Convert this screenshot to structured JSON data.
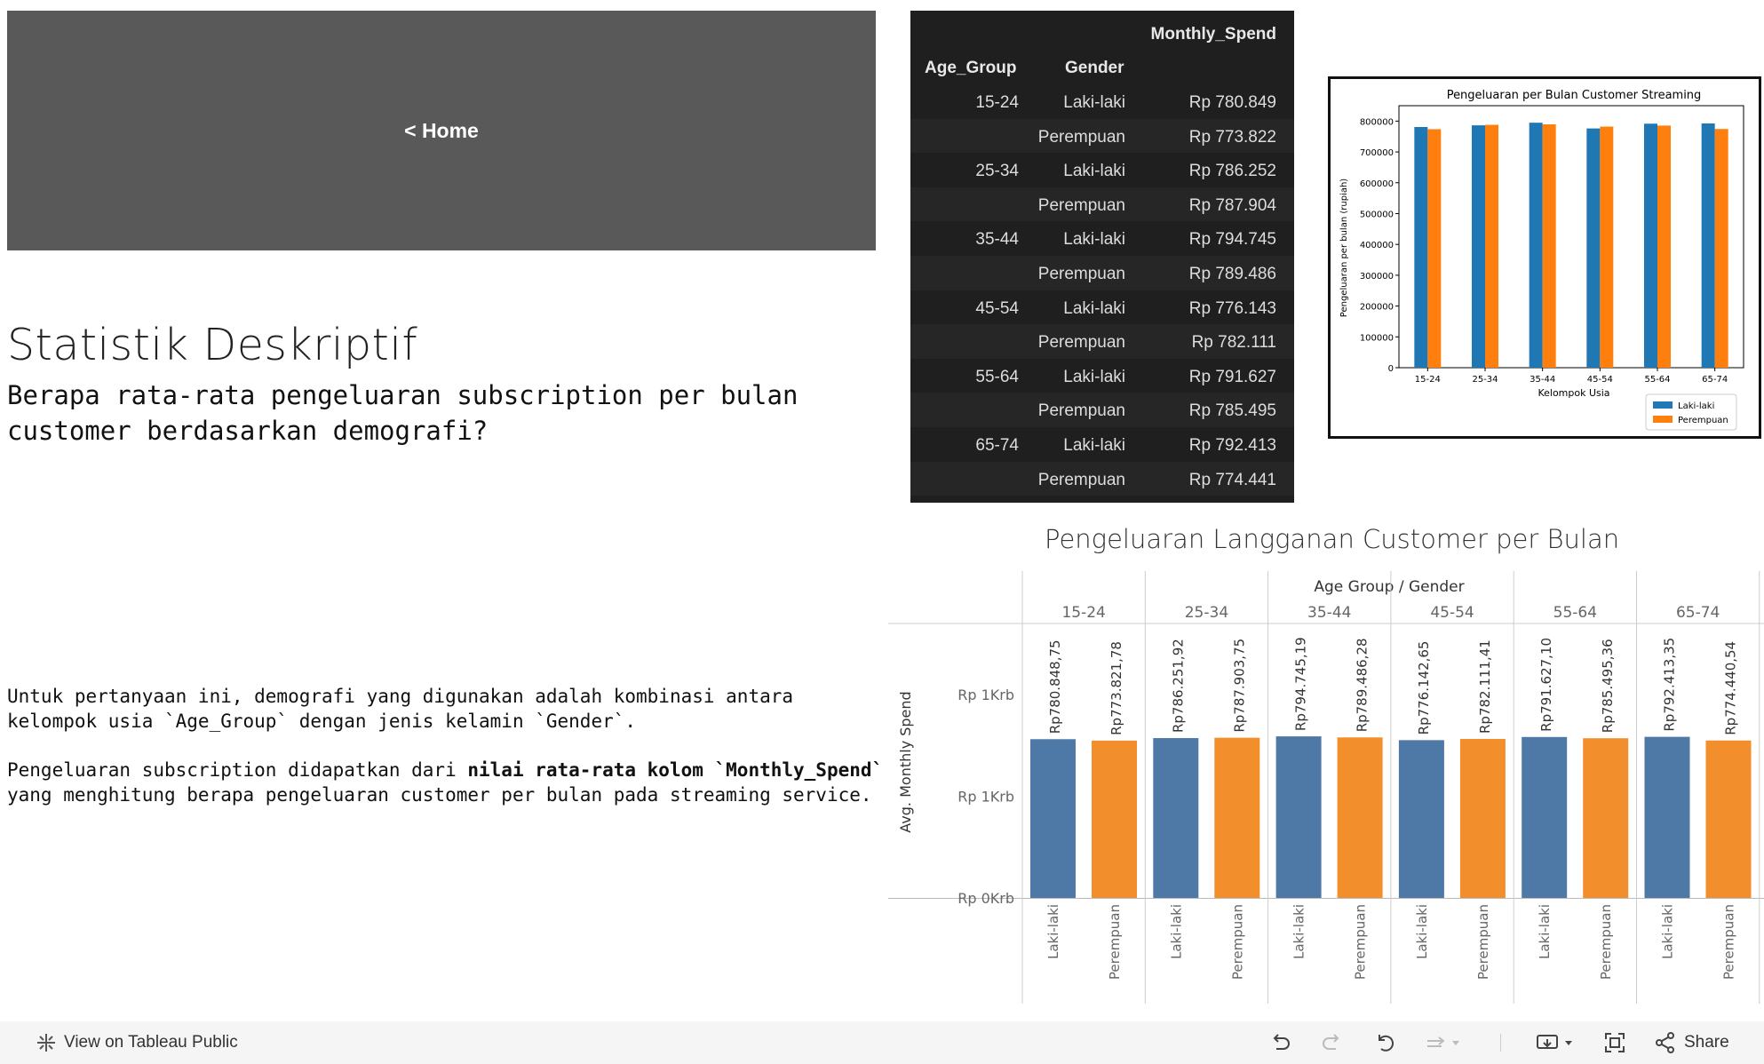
{
  "home": {
    "label": "< Home"
  },
  "heading": {
    "title": "Statistik Deskriptif",
    "subtitle": "Berapa rata-rata pengeluaran subscription per bulan customer berdasarkan demografi?"
  },
  "description": {
    "p1": "Untuk pertanyaan ini, demografi yang digunakan adalah kombinasi antara kelompok usia `Age_Group` dengan jenis kelamin `Gender`.",
    "p2_a": "Pengeluaran subscription didapatkan dari ",
    "p2_b": "nilai rata-rata kolom `Monthly_Spend`",
    "p2_c": " yang menghitung berapa pengeluaran customer per bulan pada streaming service."
  },
  "table": {
    "header_value": "Monthly_Spend",
    "header_age": "Age_Group",
    "header_gender": "Gender",
    "rows": [
      {
        "age": "15-24",
        "gender": "Laki-laki",
        "value": "Rp 780.849"
      },
      {
        "age": "",
        "gender": "Perempuan",
        "value": "Rp 773.822"
      },
      {
        "age": "25-34",
        "gender": "Laki-laki",
        "value": "Rp 786.252"
      },
      {
        "age": "",
        "gender": "Perempuan",
        "value": "Rp 787.904"
      },
      {
        "age": "35-44",
        "gender": "Laki-laki",
        "value": "Rp 794.745"
      },
      {
        "age": "",
        "gender": "Perempuan",
        "value": "Rp 789.486"
      },
      {
        "age": "45-54",
        "gender": "Laki-laki",
        "value": "Rp 776.143"
      },
      {
        "age": "",
        "gender": "Perempuan",
        "value": "Rp 782.111"
      },
      {
        "age": "55-64",
        "gender": "Laki-laki",
        "value": "Rp 791.627"
      },
      {
        "age": "",
        "gender": "Perempuan",
        "value": "Rp 785.495"
      },
      {
        "age": "65-74",
        "gender": "Laki-laki",
        "value": "Rp 792.413"
      },
      {
        "age": "",
        "gender": "Perempuan",
        "value": "Rp 774.441"
      }
    ]
  },
  "chart_data": [
    {
      "type": "bar",
      "title": "Pengeluaran per Bulan Customer Streaming",
      "xlabel": "Kelompok Usia",
      "ylabel": "Pengeluaran per bulan (rupiah)",
      "categories": [
        "15-24",
        "25-34",
        "35-44",
        "45-54",
        "55-64",
        "65-74"
      ],
      "ylim": [
        0,
        850000
      ],
      "yticks": [
        "0",
        "100000",
        "200000",
        "300000",
        "400000",
        "500000",
        "600000",
        "700000",
        "800000"
      ],
      "legend_position": "bottom-right",
      "series": [
        {
          "name": "Laki-laki",
          "color": "#1f77b4",
          "values": [
            780849,
            786252,
            794745,
            776143,
            791627,
            792413
          ]
        },
        {
          "name": "Perempuan",
          "color": "#ff7f0e",
          "values": [
            773822,
            787904,
            789486,
            782111,
            785495,
            774441
          ]
        }
      ]
    },
    {
      "type": "bar",
      "title": "Pengeluaran Langganan Customer per Bulan",
      "column_header": "Age Group / Gender",
      "ylabel": "Avg. Monthly Spend",
      "y_tick_labels": [
        "Rp 1Krb",
        "Rp 1Krb",
        "Rp 0Krb"
      ],
      "categories": [
        "15-24",
        "25-34",
        "35-44",
        "45-54",
        "55-64",
        "65-74"
      ],
      "genders": [
        "Laki-laki",
        "Perempuan"
      ],
      "colors": {
        "Laki-laki": "#4e79a7",
        "Perempuan": "#f28e2b"
      },
      "values": [
        780848.75,
        773821.78,
        786251.92,
        787903.75,
        794745.19,
        789486.28,
        776142.65,
        782111.41,
        791627.1,
        785495.36,
        792413.35,
        774440.54
      ],
      "data_labels": [
        "Rp780.848,75",
        "Rp773.821,78",
        "Rp786.251,92",
        "Rp787.903,75",
        "Rp794.745,19",
        "Rp789.486,28",
        "Rp776.142,65",
        "Rp782.111,41",
        "Rp791.627,10",
        "Rp785.495,36",
        "Rp792.413,35",
        "Rp774.440,54"
      ]
    }
  ],
  "toolbar": {
    "view_label": "View on Tableau Public",
    "share_label": "Share"
  }
}
